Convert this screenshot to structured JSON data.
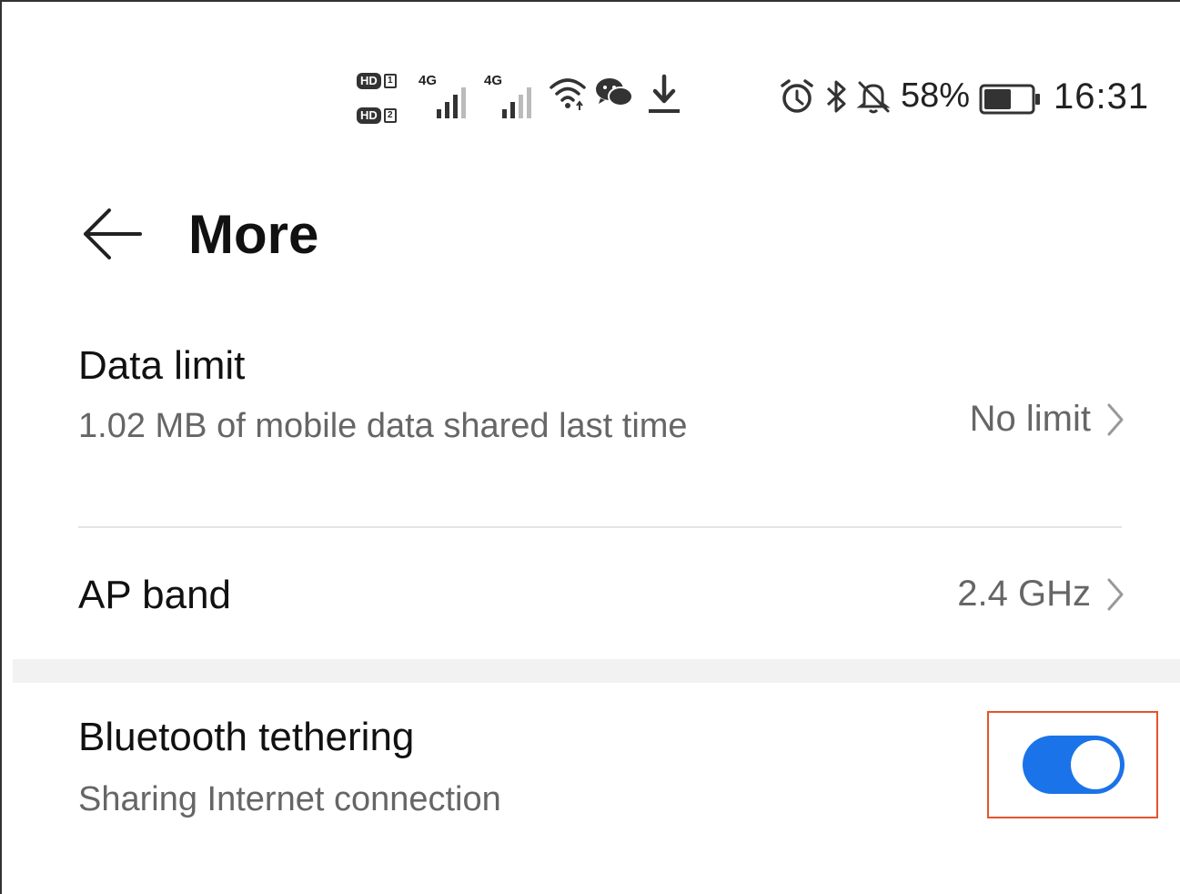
{
  "status_bar": {
    "hd_label_1": "HD",
    "hd_sim_1": "1",
    "hd_label_2": "HD",
    "hd_sim_2": "2",
    "signal_1_label": "4G",
    "signal_2_label": "4G",
    "battery_percent": "58%",
    "battery_level": 0.58,
    "time": "16:31",
    "icons": [
      "hd-icon",
      "signal-4g-icon",
      "signal-4g-icon",
      "wifi-icon",
      "wechat-icon",
      "download-icon",
      "alarm-icon",
      "bluetooth-icon",
      "bell-muted-icon",
      "battery-icon"
    ]
  },
  "header": {
    "title": "More",
    "back_icon": "arrow-left-icon"
  },
  "settings": {
    "data_limit": {
      "title": "Data limit",
      "subtitle": "1.02 MB of mobile data shared last time",
      "value": "No limit"
    },
    "ap_band": {
      "title": "AP band",
      "value": "2.4 GHz"
    },
    "bluetooth_tethering": {
      "title": "Bluetooth tethering",
      "subtitle": "Sharing Internet connection",
      "enabled": true
    }
  },
  "colors": {
    "toggle_on": "#1a73e8",
    "highlight_border": "#e5542b"
  }
}
